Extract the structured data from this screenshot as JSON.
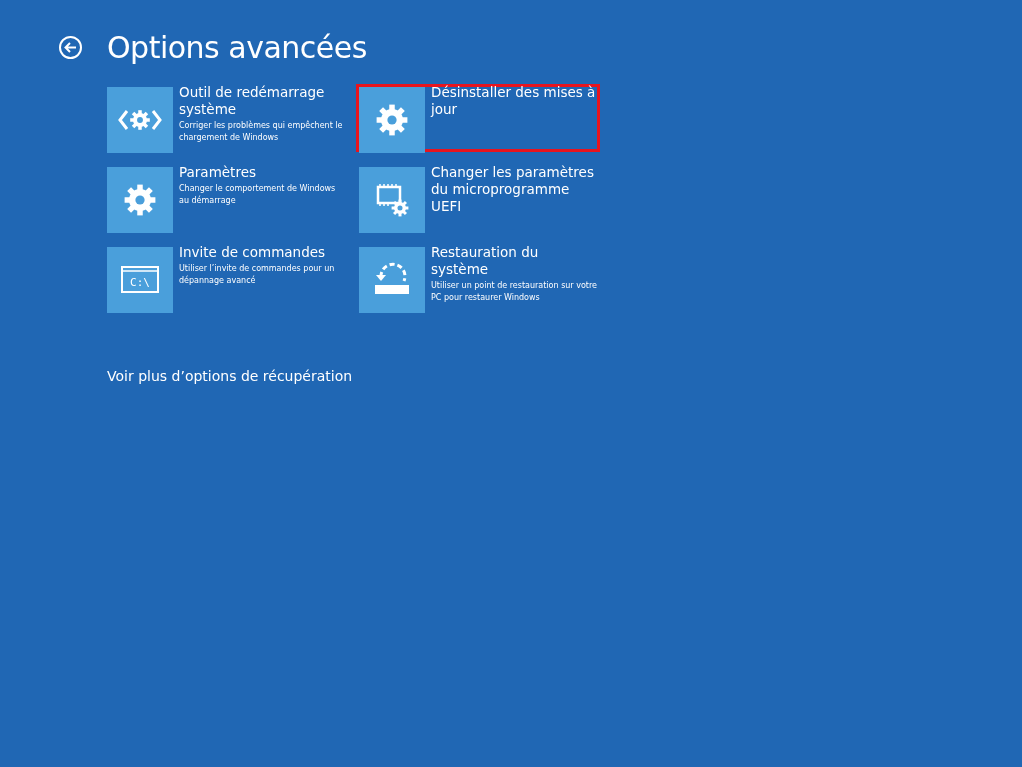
{
  "header": {
    "title": "Options avancées"
  },
  "options": [
    {
      "kind": "repair",
      "title": "Outil de redémarrage système",
      "description": "Corriger les problèmes qui empêchent le chargement de Windows",
      "highlighted": false
    },
    {
      "kind": "gear",
      "title": "Désinstaller des mises à jour",
      "highlighted": true
    },
    {
      "kind": "gear",
      "title": "Paramètres",
      "description": "Changer le comportement de Windows au démarrage",
      "highlighted": false
    },
    {
      "kind": "firmware",
      "title": "Changer les paramètres du microprogramme UEFI",
      "highlighted": false
    },
    {
      "kind": "console",
      "icon_text": "C:\\",
      "title": "Invite de commandes",
      "description": "Utiliser l’invite de commandes pour un dépannage avancé",
      "highlighted": false
    },
    {
      "kind": "restore",
      "title": "Restauration du système",
      "description": "Utiliser un point de restauration sur votre PC pour restaurer Windows",
      "highlighted": false
    }
  ],
  "more_link": "Voir plus d’options de récupération"
}
